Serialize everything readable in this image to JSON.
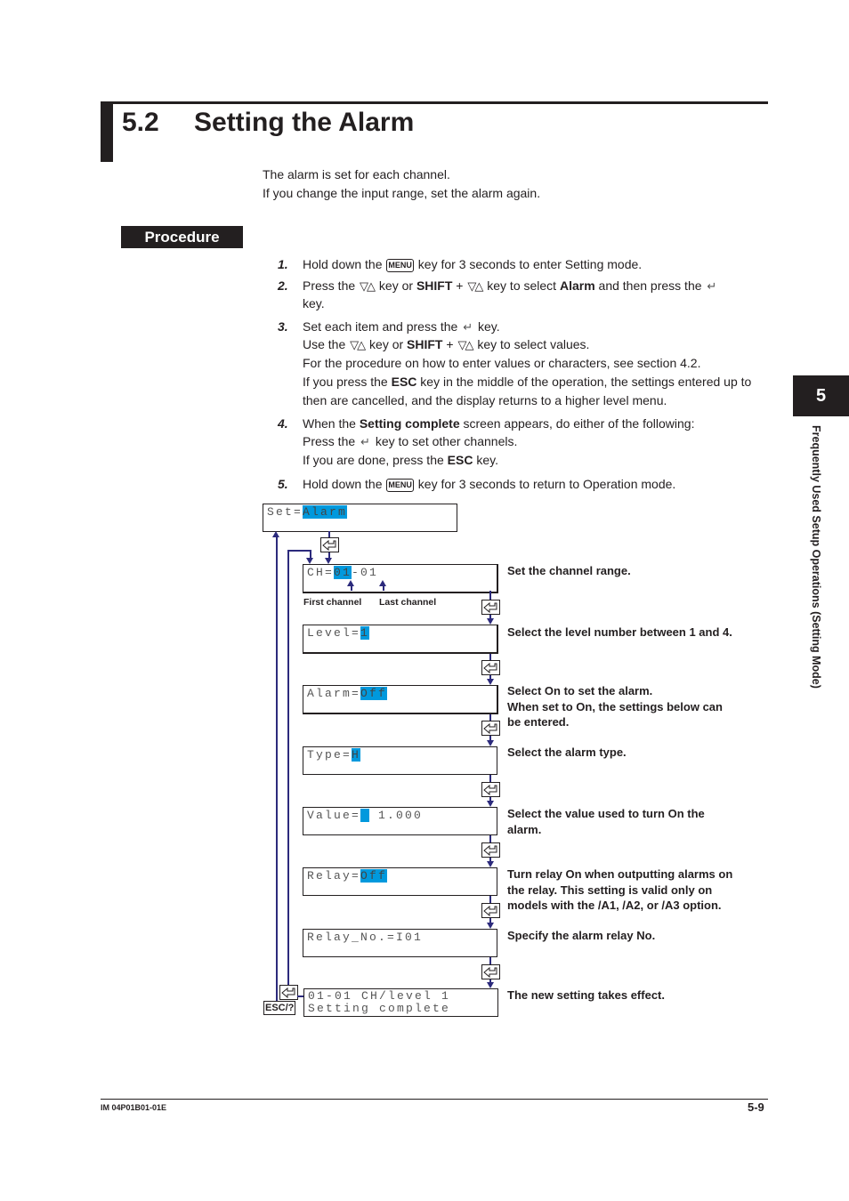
{
  "section": {
    "number": "5.2",
    "title": "Setting the Alarm"
  },
  "intro": [
    "The alarm is set for each channel.",
    "If you change the input range, set the alarm again."
  ],
  "procedure_label": "Procedure",
  "keys": {
    "menu": "MENU",
    "updown": "▽△",
    "shift": "SHIFT",
    "esc": "ESC",
    "esc_help": "ESC/?",
    "enter": "⏎"
  },
  "steps": {
    "s1": {
      "num": "1.",
      "a": "Hold down the",
      "b": "key for 3 seconds to enter Setting mode."
    },
    "s2": {
      "num": "2.",
      "a": "Press the",
      "b": "key or",
      "c": "+",
      "d": "key to select",
      "e": "Alarm",
      "f": "and then press the",
      "g": "key."
    },
    "s3": {
      "num": "3.",
      "l1a": "Set each item and press the",
      "l1b": "key.",
      "l2a": "Use the",
      "l2b": "key or",
      "l2c": "+",
      "l2d": "key to select values.",
      "l3": "For the procedure on how to enter values or characters, see section 4.2.",
      "l4a": "If you press the",
      "l4b": "key in the middle of the operation, the settings entered up to",
      "l5": "then are cancelled, and the display returns to a higher level menu."
    },
    "s4": {
      "num": "4.",
      "l1a": "When the",
      "l1b": "Setting complete",
      "l1c": "screen appears, do either of the following:",
      "l2a": "Press the",
      "l2b": "key to set other channels.",
      "l3a": "If you are done, press the",
      "l3b": "key."
    },
    "s5": {
      "num": "5.",
      "a": "Hold down the",
      "b": "key for 3 seconds to return to Operation mode."
    }
  },
  "flow": {
    "set": {
      "label": "Set=",
      "value": "Alarm"
    },
    "ch": {
      "label": "CH=",
      "first": "01",
      "sep": "-",
      "last": "01",
      "first_caption": "First channel",
      "last_caption": "Last channel",
      "note": "Set the channel range."
    },
    "level": {
      "label": "Level=",
      "value": "1",
      "note": "Select the level number between 1 and 4."
    },
    "alarm": {
      "label": "Alarm=",
      "value": "Off",
      "note": [
        "Select On to set the alarm.",
        "When set to On, the settings below can",
        "be entered."
      ]
    },
    "type": {
      "label": "Type=",
      "value": "H",
      "note": "Select the alarm type."
    },
    "value": {
      "label": "Value=",
      "value": " ",
      "rest": " 1.000",
      "note": [
        "Select the value used to turn On the",
        "alarm."
      ]
    },
    "relay": {
      "label": "Relay=",
      "value": "Off",
      "note": [
        "Turn relay On when outputting alarms on",
        "the relay. This setting is valid only on",
        "models with the /A1, /A2, or /A3 option."
      ]
    },
    "relay_no": {
      "label": "Relay_No.=I01",
      "note": "Specify the alarm relay No."
    },
    "complete": {
      "line1": "01-01 CH/level 1",
      "line2": "Setting complete",
      "note": "The new setting takes effect."
    }
  },
  "chapter": {
    "number": "5",
    "title": "Frequently Used Setup Operations (Setting Mode)"
  },
  "footer": {
    "doc_id": "IM 04P01B01-01E",
    "page": "5-9"
  },
  "colors": {
    "highlight": "#0099dd",
    "flow_line": "#2c2a7c",
    "ink": "#231f20"
  }
}
